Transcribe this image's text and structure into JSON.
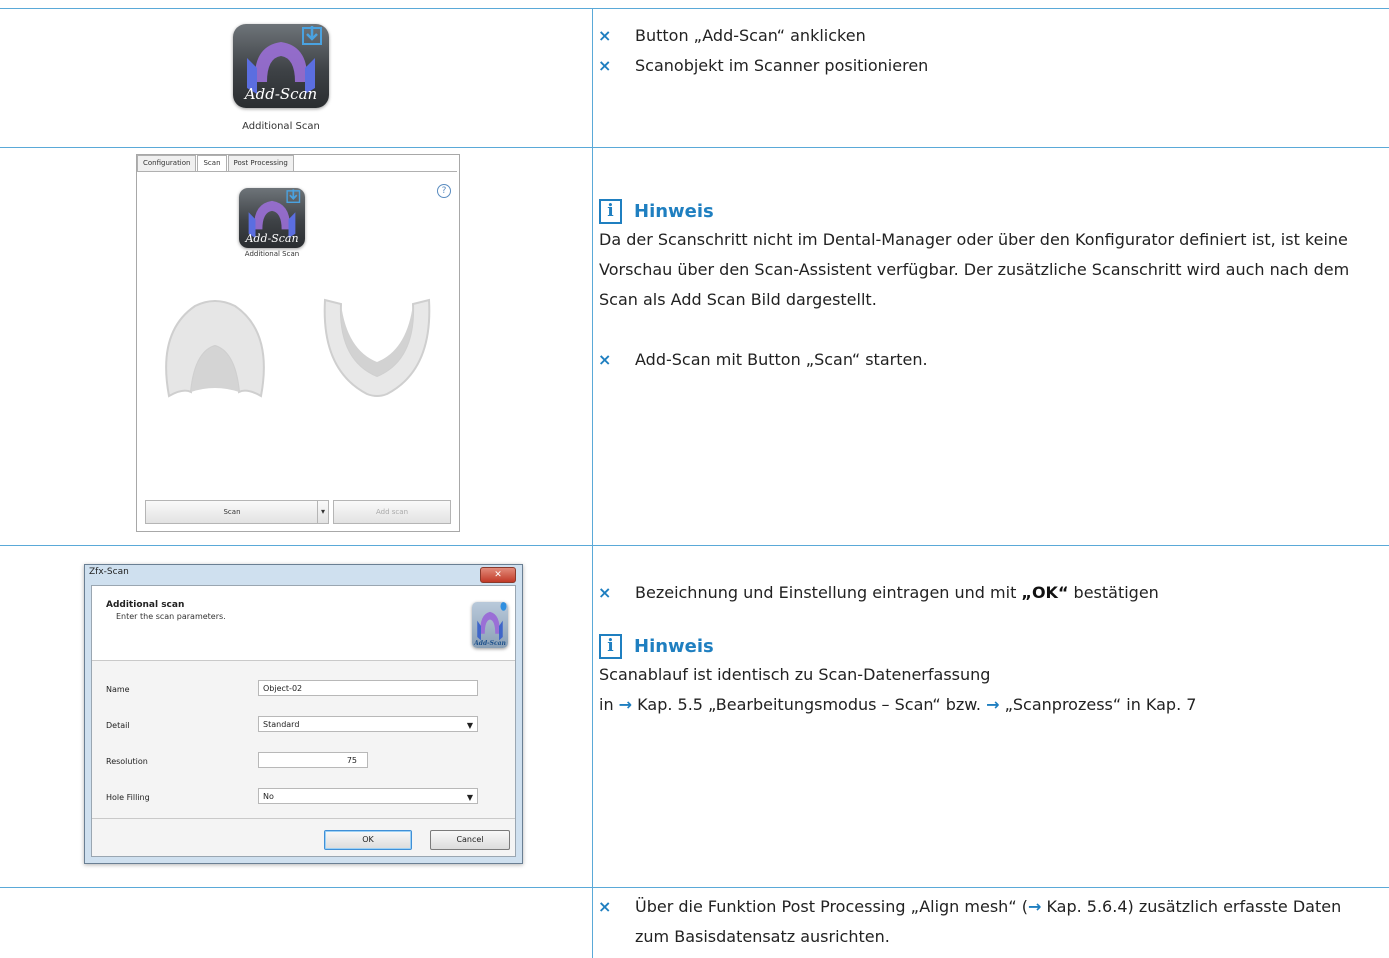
{
  "row1": {
    "icon_label": "Add-Scan",
    "icon_caption": "Additional Scan",
    "steps": [
      "Button „Add-Scan“ anklicken",
      "Scanobjekt im Scanner positionieren"
    ]
  },
  "row2": {
    "tabs": [
      "Configuration",
      "Scan",
      "Post Processing"
    ],
    "icon_label": "Add-Scan",
    "icon_caption": "Additional Scan",
    "scan_button": "Scan",
    "add_scan_button": "Add scan",
    "hint_title": "Hinweis",
    "hint_text": "Da der Scanschritt nicht im Dental-Manager oder über den Konfigurator definiert ist, ist keine Vorschau über den Scan-Assistent verfügbar. Der zusätzliche Scanschritt wird auch nach dem Scan als Add Scan Bild dargestellt.",
    "step": "Add-Scan mit Button „Scan“ starten."
  },
  "row3": {
    "dialog": {
      "window_title": "Zfx-Scan",
      "heading": "Additional scan",
      "subheading": "Enter the scan parameters.",
      "icon_label": "Add-Scan",
      "fields": [
        {
          "label": "Name",
          "value": "Object-02"
        },
        {
          "label": "Detail",
          "value": "Standard"
        },
        {
          "label": "Resolution",
          "value": "75"
        },
        {
          "label": "Hole Filling",
          "value": "No"
        }
      ],
      "ok": "OK",
      "cancel": "Cancel"
    },
    "step_prefix": "Bezeichnung und Einstellung eintragen und mit ",
    "step_bold": "„OK“",
    "step_suffix": " bestätigen",
    "hint_title": "Hinweis",
    "hint_line1": "Scanablauf ist identisch zu Scan-Datenerfassung",
    "hint_line2_a": "in ",
    "hint_line2_b": "Kap. 5.5 „Bearbeitungsmodus – Scan“ bzw. ",
    "hint_line2_c": "„Scanprozess“ in Kap. 7"
  },
  "row4": {
    "step_a": "Über die Funktion Post Processing „Align mesh“ (",
    "step_b": "Kap. 5.6.4) zusätzlich erfasste Daten zum Basisdatensatz ausrichten."
  },
  "symbols": {
    "bullet": "×",
    "arrow": "→",
    "hint": "i"
  },
  "colors": {
    "accent": "#1f7fc0",
    "rule": "#5aa9d8"
  }
}
